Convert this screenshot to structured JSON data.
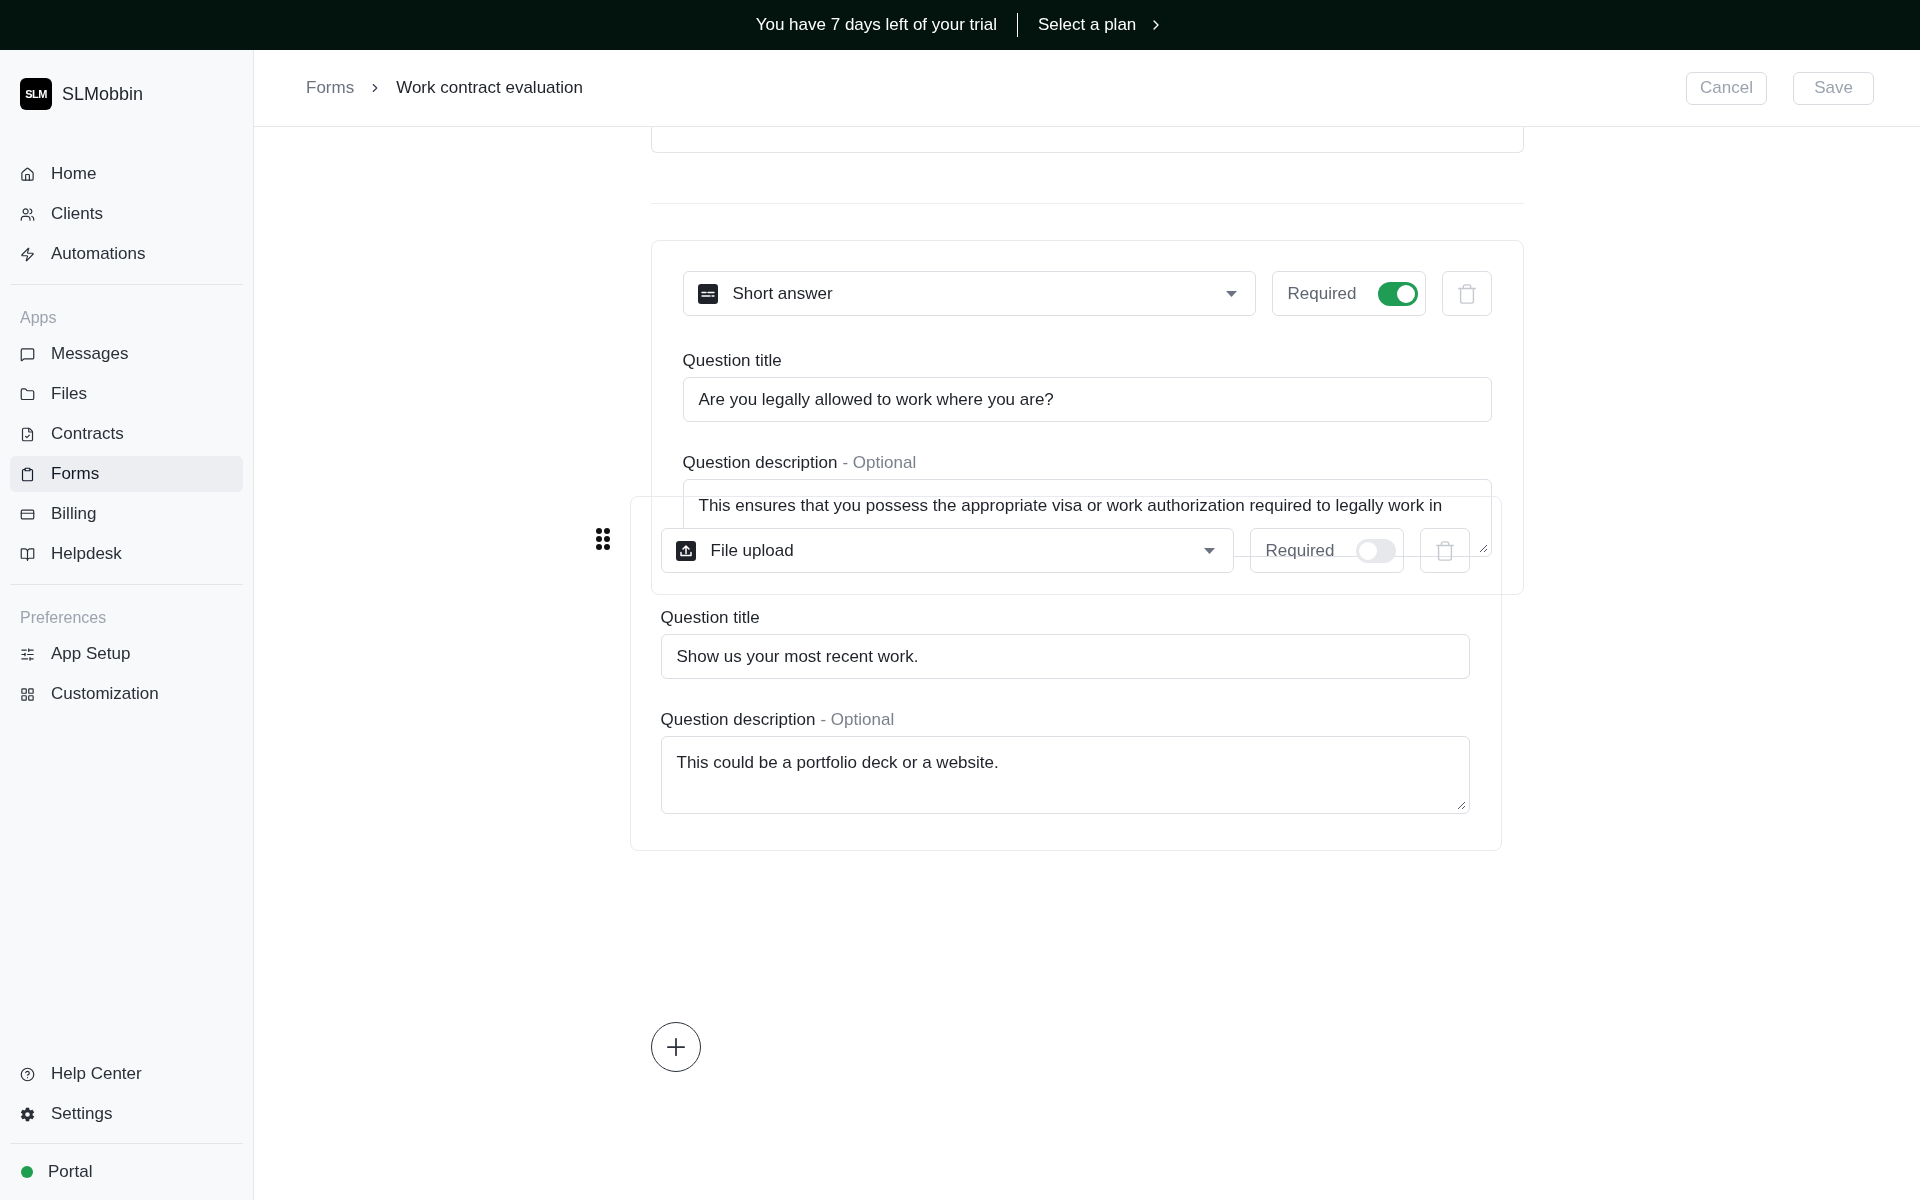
{
  "banner": {
    "message": "You have 7 days left of your trial",
    "link": "Select a plan"
  },
  "sidebar": {
    "brand": {
      "logo": "SLM",
      "name": "SLMobbin"
    },
    "sections": [
      {
        "items": [
          {
            "label": "Home",
            "selected": false
          },
          {
            "label": "Clients",
            "selected": false
          },
          {
            "label": "Automations",
            "selected": false
          }
        ]
      },
      {
        "heading": "Apps",
        "items": [
          {
            "label": "Messages",
            "selected": false
          },
          {
            "label": "Files",
            "selected": false
          },
          {
            "label": "Contracts",
            "selected": false
          },
          {
            "label": "Forms",
            "selected": true
          },
          {
            "label": "Billing",
            "selected": false
          },
          {
            "label": "Helpdesk",
            "selected": false
          }
        ]
      },
      {
        "heading": "Preferences",
        "items": [
          {
            "label": "App Setup",
            "selected": false
          },
          {
            "label": "Customization",
            "selected": false
          }
        ]
      }
    ],
    "footer_items": [
      {
        "label": "Help Center",
        "selected": false
      },
      {
        "label": "Settings",
        "selected": false
      }
    ],
    "portal": {
      "label": "Portal",
      "color": "#1e9e4f"
    }
  },
  "header": {
    "breadcrumb": [
      {
        "label": "Forms",
        "current": false
      },
      {
        "label": "Work contract evaluation",
        "current": true
      }
    ],
    "buttons": [
      {
        "label": "Cancel",
        "disabled": true
      },
      {
        "label": "Save",
        "disabled": true
      }
    ]
  },
  "form": {
    "questions": [
      {
        "kind": "short_answer",
        "type": "Short answer",
        "required_label": "Required",
        "required": true,
        "title_label": "Question title",
        "title": "Are you legally allowed to work where you are?",
        "description_label": "Question description",
        "optional_note": "- Optional",
        "description": "This ensures that you possess the appropriate visa or work authorization required to legally work in",
        "dragging": false
      },
      {
        "kind": "file_upload",
        "type": "File upload",
        "required_label": "Required",
        "required": false,
        "title_label": "Question title",
        "title": "Show us your most recent work.",
        "description_label": "Question description",
        "optional_note": "- Optional",
        "description": "This could be a portfolio deck or a website.",
        "dragging": true
      }
    ]
  }
}
